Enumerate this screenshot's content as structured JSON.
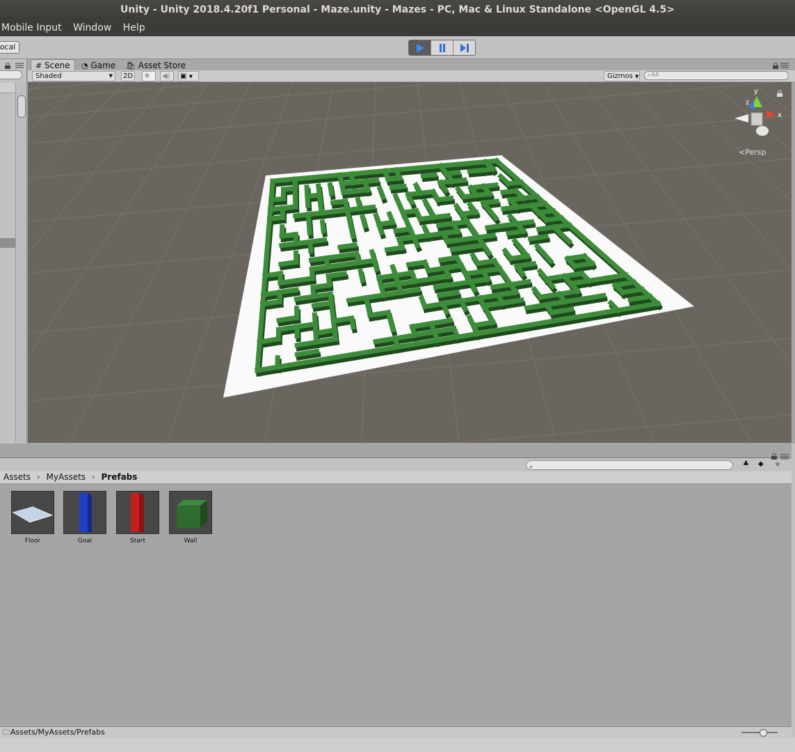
{
  "window": {
    "title": "Unity - Unity 2018.4.20f1 Personal - Maze.unity - Mazes - PC, Mac & Linux Standalone <OpenGL 4.5>"
  },
  "menu": {
    "items": [
      "Mobile Input",
      "Window",
      "Help"
    ]
  },
  "toolbar": {
    "pivot_label": "ocal",
    "play_state": "playing"
  },
  "scene_view": {
    "tabs": [
      {
        "label": "Scene",
        "icon": "grid-icon",
        "active": true
      },
      {
        "label": "Game",
        "icon": "pacman-icon",
        "active": false
      },
      {
        "label": "Asset Store",
        "icon": "store-icon",
        "active": false
      }
    ],
    "shading_mode": "Shaded",
    "mode_2d_label": "2D",
    "gizmos_label": "Gizmos",
    "search_placeholder": "All",
    "projection_label": "Persp",
    "axis_labels": {
      "x": "x",
      "y": "y",
      "z": "z"
    },
    "maze_color": "#3c8c3a",
    "floor_color": "#ffffff",
    "background_color": "#6b6560"
  },
  "project": {
    "breadcrumb": [
      "Assets",
      "MyAssets",
      "Prefabs"
    ],
    "assets": [
      {
        "name": "Floor",
        "kind": "plane",
        "color": "#b9c8dc"
      },
      {
        "name": "Goal",
        "kind": "pillar",
        "color": "#1f3fc4"
      },
      {
        "name": "Start",
        "kind": "pillar",
        "color": "#c41f1f"
      },
      {
        "name": "Wall",
        "kind": "cube",
        "color": "#2f6b2e"
      }
    ],
    "status_path": "Assets/MyAssets/Prefabs"
  }
}
